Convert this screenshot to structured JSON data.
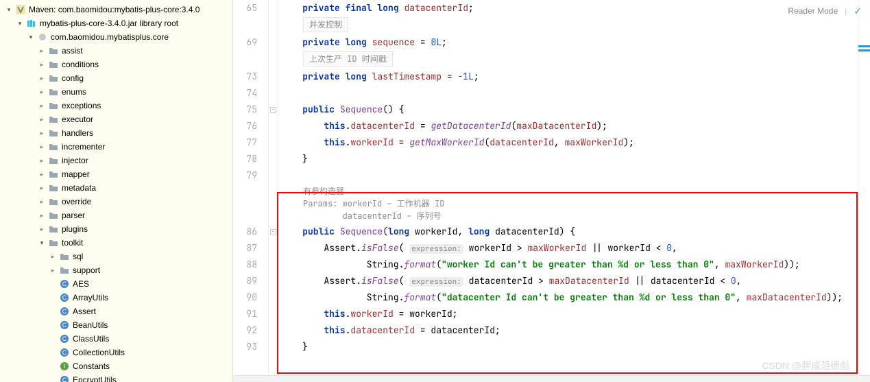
{
  "topRight": {
    "readerMode": "Reader Mode"
  },
  "watermark": "CSDN @胖成范德彪",
  "sidebar": {
    "root": {
      "prefix": "Maven: ",
      "label": "com.baomidou:mybatis-plus-core:3.4.0"
    },
    "jar": {
      "label": "mybatis-plus-core-3.4.0.jar",
      "suffix": "library root"
    },
    "pkg": "com.baomidou.mybatisplus.core",
    "folders": [
      "assist",
      "conditions",
      "config",
      "enums",
      "exceptions",
      "executor",
      "handlers",
      "incrementer",
      "injector",
      "mapper",
      "metadata",
      "override",
      "parser",
      "plugins"
    ],
    "toolkit": {
      "label": "toolkit",
      "sql": "sql",
      "support": "support",
      "classes": [
        {
          "name": "AES",
          "type": "class"
        },
        {
          "name": "ArrayUtils",
          "type": "class"
        },
        {
          "name": "Assert",
          "type": "class"
        },
        {
          "name": "BeanUtils",
          "type": "class"
        },
        {
          "name": "ClassUtils",
          "type": "class"
        },
        {
          "name": "CollectionUtils",
          "type": "class"
        },
        {
          "name": "Constants",
          "type": "iface"
        },
        {
          "name": "EncryptUtils",
          "type": "class"
        }
      ]
    }
  },
  "editor": {
    "lines": {
      "l65": {
        "num": "65",
        "tokens": [
          {
            "t": "private ",
            "c": "k"
          },
          {
            "t": "final ",
            "c": "k"
          },
          {
            "t": "long ",
            "c": "k"
          },
          {
            "t": "datacenterId",
            "c": "id"
          },
          {
            "t": ";",
            "c": ""
          }
        ]
      },
      "doc1": "并发控制",
      "l69": {
        "num": "69",
        "tokens": [
          {
            "t": "private ",
            "c": "k"
          },
          {
            "t": "long ",
            "c": "k"
          },
          {
            "t": "sequence",
            "c": "id"
          },
          {
            "t": " = ",
            "c": ""
          },
          {
            "t": "0L",
            "c": "n"
          },
          {
            "t": ";",
            "c": ""
          }
        ]
      },
      "doc2": "上次生产 ID 时间戳",
      "l73": {
        "num": "73",
        "tokens": [
          {
            "t": "private ",
            "c": "k"
          },
          {
            "t": "long ",
            "c": "k"
          },
          {
            "t": "lastTimestamp",
            "c": "id"
          },
          {
            "t": " = ",
            "c": ""
          },
          {
            "t": "-1L",
            "c": "n"
          },
          {
            "t": ";",
            "c": ""
          }
        ]
      },
      "l74": {
        "num": "74"
      },
      "l75": {
        "num": "75",
        "tokens": [
          {
            "t": "public ",
            "c": "k"
          },
          {
            "t": "Sequence",
            "c": "fn"
          },
          {
            "t": "() {",
            "c": ""
          }
        ]
      },
      "l76": {
        "num": "76",
        "tokens": [
          {
            "t": "    ",
            "c": ""
          },
          {
            "t": "this",
            "c": "k"
          },
          {
            "t": ".",
            "c": ""
          },
          {
            "t": "datacenterId",
            "c": "id"
          },
          {
            "t": " = ",
            "c": ""
          },
          {
            "t": "getDatacenterId",
            "c": "fni"
          },
          {
            "t": "(",
            "c": ""
          },
          {
            "t": "maxDatacenterId",
            "c": "id"
          },
          {
            "t": ");",
            "c": ""
          }
        ]
      },
      "l77": {
        "num": "77",
        "tokens": [
          {
            "t": "    ",
            "c": ""
          },
          {
            "t": "this",
            "c": "k"
          },
          {
            "t": ".",
            "c": ""
          },
          {
            "t": "workerId",
            "c": "id"
          },
          {
            "t": " = ",
            "c": ""
          },
          {
            "t": "getMaxWorkerId",
            "c": "fni"
          },
          {
            "t": "(",
            "c": ""
          },
          {
            "t": "datacenterId",
            "c": "id"
          },
          {
            "t": ", ",
            "c": ""
          },
          {
            "t": "maxWorkerId",
            "c": "id"
          },
          {
            "t": ");",
            "c": ""
          }
        ]
      },
      "l78": {
        "num": "78",
        "tokens": [
          {
            "t": "}",
            "c": ""
          }
        ]
      },
      "l79": {
        "num": "79"
      },
      "doc3_l1": "有参构造器",
      "doc3_l2": "Params: workerId – 工作机器 ID",
      "doc3_l3": "        datacenterId – 序列号",
      "l86": {
        "num": "86",
        "tokens": [
          {
            "t": "public ",
            "c": "k"
          },
          {
            "t": "Sequence",
            "c": "fn"
          },
          {
            "t": "(",
            "c": ""
          },
          {
            "t": "long ",
            "c": "k"
          },
          {
            "t": "workerId, ",
            "c": ""
          },
          {
            "t": "long ",
            "c": "k"
          },
          {
            "t": "datacenterId) {",
            "c": ""
          }
        ]
      },
      "l87": {
        "num": "87",
        "tokens": [
          {
            "t": "    Assert.",
            "c": ""
          },
          {
            "t": "isFalse",
            "c": "fni"
          },
          {
            "t": "( ",
            "c": ""
          },
          {
            "t": "expression:",
            "c": "hint"
          },
          {
            "t": " workerId > ",
            "c": ""
          },
          {
            "t": "maxWorkerId",
            "c": "id"
          },
          {
            "t": " || workerId < ",
            "c": ""
          },
          {
            "t": "0",
            "c": "n"
          },
          {
            "t": ",",
            "c": ""
          }
        ]
      },
      "l88": {
        "num": "88",
        "tokens": [
          {
            "t": "            String.",
            "c": ""
          },
          {
            "t": "format",
            "c": "fni"
          },
          {
            "t": "(",
            "c": ""
          },
          {
            "t": "\"worker Id can't be greater than %d or less than 0\"",
            "c": "s"
          },
          {
            "t": ", ",
            "c": ""
          },
          {
            "t": "maxWorkerId",
            "c": "id"
          },
          {
            "t": "));",
            "c": ""
          }
        ]
      },
      "l89": {
        "num": "89",
        "tokens": [
          {
            "t": "    Assert.",
            "c": ""
          },
          {
            "t": "isFalse",
            "c": "fni"
          },
          {
            "t": "( ",
            "c": ""
          },
          {
            "t": "expression:",
            "c": "hint"
          },
          {
            "t": " datacenterId > ",
            "c": ""
          },
          {
            "t": "maxDatacenterId",
            "c": "id"
          },
          {
            "t": " || datacenterId < ",
            "c": ""
          },
          {
            "t": "0",
            "c": "n"
          },
          {
            "t": ",",
            "c": ""
          }
        ]
      },
      "l90": {
        "num": "90",
        "tokens": [
          {
            "t": "            String.",
            "c": ""
          },
          {
            "t": "format",
            "c": "fni"
          },
          {
            "t": "(",
            "c": ""
          },
          {
            "t": "\"datacenter Id can't be greater than %d or less than 0\"",
            "c": "s"
          },
          {
            "t": ", ",
            "c": ""
          },
          {
            "t": "maxDatacenterId",
            "c": "id"
          },
          {
            "t": "));",
            "c": ""
          }
        ]
      },
      "l91": {
        "num": "91",
        "tokens": [
          {
            "t": "    ",
            "c": ""
          },
          {
            "t": "this",
            "c": "k"
          },
          {
            "t": ".",
            "c": ""
          },
          {
            "t": "workerId",
            "c": "id"
          },
          {
            "t": " = workerId;",
            "c": ""
          }
        ]
      },
      "l92": {
        "num": "92",
        "tokens": [
          {
            "t": "    ",
            "c": ""
          },
          {
            "t": "this",
            "c": "k"
          },
          {
            "t": ".",
            "c": ""
          },
          {
            "t": "datacenterId",
            "c": "id"
          },
          {
            "t": " = datacenterId;",
            "c": ""
          }
        ]
      },
      "l93": {
        "num": "93",
        "tokens": [
          {
            "t": "}",
            "c": ""
          }
        ]
      }
    }
  }
}
